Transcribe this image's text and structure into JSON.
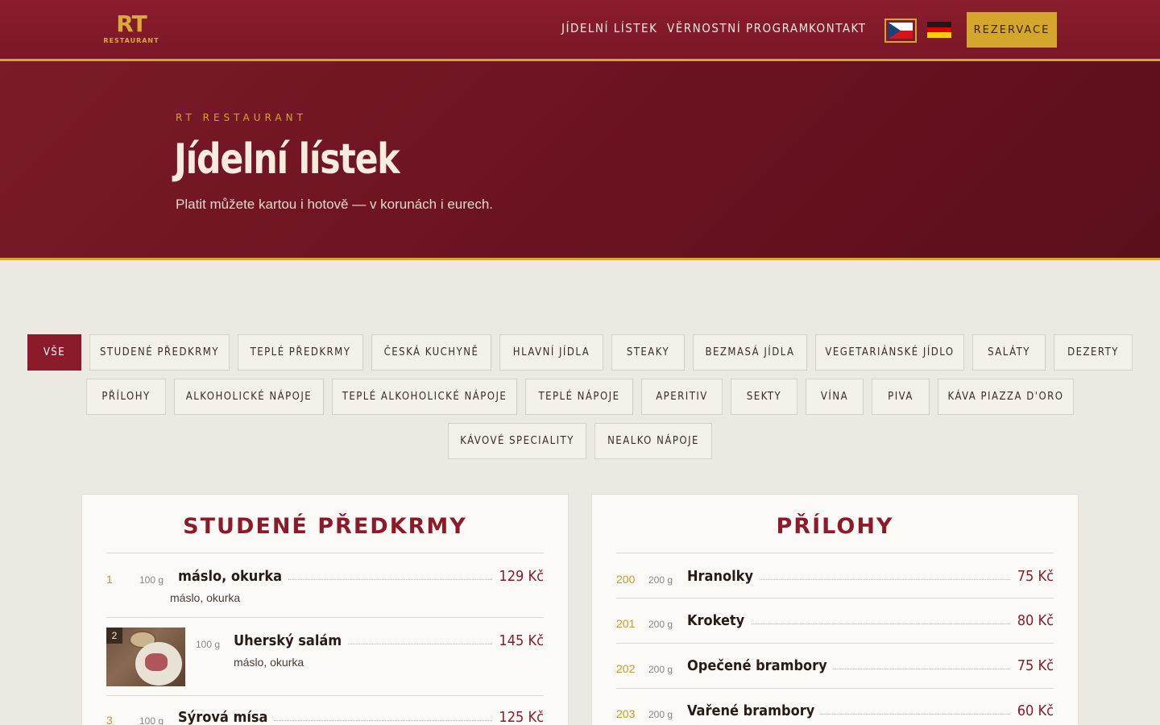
{
  "header": {
    "logo_big": "RT",
    "logo_small": "RESTAURANT",
    "nav": [
      {
        "label": "JÍDELNÍ LÍSTEK"
      },
      {
        "label": "VĚRNOSTNÍ PROGRAM"
      },
      {
        "label": "KONTAKT"
      }
    ],
    "reservation_label": "REZERVACE",
    "languages": [
      "cz-flag-icon",
      "de-flag-icon"
    ]
  },
  "hero": {
    "kicker": "RT RESTAURANT",
    "title": "Jídelní lístek",
    "subtitle": "Platit můžete kartou i hotově — v korunách i eurech."
  },
  "filters": [
    {
      "label": "VŠE",
      "active": true
    },
    {
      "label": "STUDENÉ PŘEDKRMY"
    },
    {
      "label": "TEPLÉ PŘEDKRMY"
    },
    {
      "label": "ČESKÁ KUCHYNĚ"
    },
    {
      "label": "HLAVNÍ JÍDLA"
    },
    {
      "label": "STEAKY"
    },
    {
      "label": "BEZMASÁ JÍDLA"
    },
    {
      "label": "VEGETARIÁNSKÉ JÍDLO"
    },
    {
      "label": "SALÁTY"
    },
    {
      "label": "DEZERTY"
    },
    {
      "label": "PŘÍLOHY"
    },
    {
      "label": "ALKOHOLICKÉ NÁPOJE"
    },
    {
      "label": "TEPLÉ ALKOHOLICKÉ NÁPOJE"
    },
    {
      "label": "TEPLÉ NÁPOJE"
    },
    {
      "label": "APERITIV"
    },
    {
      "label": "SEKTY"
    },
    {
      "label": "VÍNA"
    },
    {
      "label": "PIVA"
    },
    {
      "label": "KÁVA PIAZZA D'ORO"
    },
    {
      "label": "KÁVOVÉ SPECIALITY"
    },
    {
      "label": "NEALKO NÁPOJE"
    }
  ],
  "menu": {
    "cold_starters": {
      "title": "STUDENÉ PŘEDKRMY",
      "items": [
        {
          "num": "1",
          "weight": "100 g",
          "name": "máslo, okurka",
          "desc": "máslo, okurka",
          "price": "129 Kč"
        },
        {
          "num": "2",
          "weight": "100 g",
          "name": "Uherský salám",
          "desc": "máslo, okurka",
          "price": "145 Kč"
        },
        {
          "num": "3",
          "weight": "100 g",
          "name": "Sýrová mísa",
          "price": "125 Kč"
        }
      ]
    },
    "sides": {
      "title": "PŘÍLOHY",
      "items": [
        {
          "num": "200",
          "weight": "200 g",
          "name": "Hranolky",
          "price": "75 Kč"
        },
        {
          "num": "201",
          "weight": "200 g",
          "name": "Krokety",
          "price": "80 Kč"
        },
        {
          "num": "202",
          "weight": "200 g",
          "name": "Opečené brambory",
          "price": "75 Kč"
        },
        {
          "num": "203",
          "weight": "200 g",
          "name": "Vařené brambory",
          "price": "60 Kč"
        }
      ]
    }
  },
  "colors": {
    "brand_red": "#8b1a2b",
    "gold": "#d4a72c"
  }
}
